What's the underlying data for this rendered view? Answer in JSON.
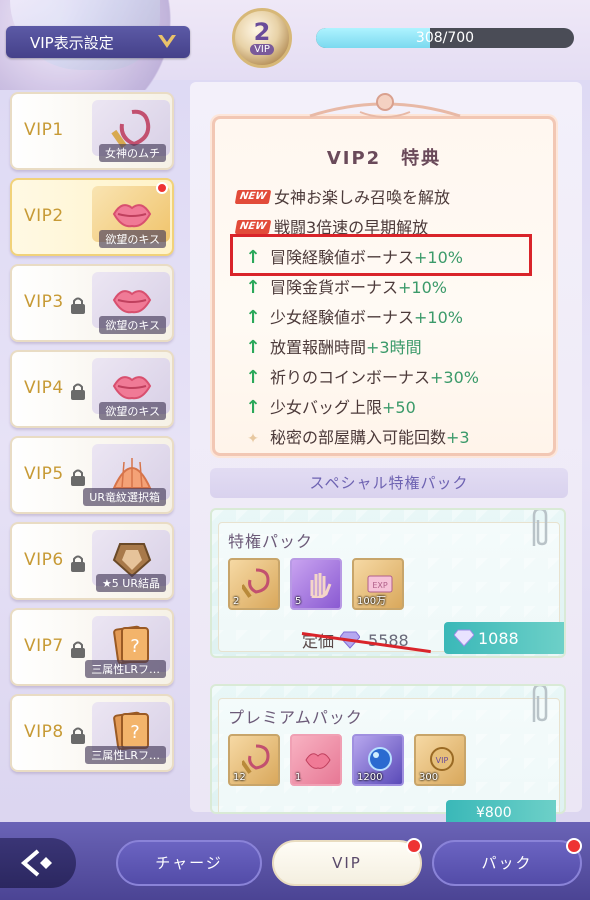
{
  "header": {
    "vip_settings_label": "VIP表示設定",
    "vip_level": "2",
    "vip_word": "VIP",
    "exp_text": "308/700",
    "exp_progress": 0.44
  },
  "sidebar": {
    "items": [
      {
        "label": "VIP1",
        "reward": "女神のムチ",
        "locked": false,
        "selected": false,
        "badge": false
      },
      {
        "label": "VIP2",
        "reward": "欲望のキス",
        "locked": false,
        "selected": true,
        "badge": true
      },
      {
        "label": "VIP3",
        "reward": "欲望のキス",
        "locked": true,
        "selected": false,
        "badge": false
      },
      {
        "label": "VIP4",
        "reward": "欲望のキス",
        "locked": true,
        "selected": false,
        "badge": false
      },
      {
        "label": "VIP5",
        "reward": "UR竜紋選択箱",
        "locked": true,
        "selected": false,
        "badge": false
      },
      {
        "label": "VIP6",
        "reward": "★5 UR結晶",
        "locked": true,
        "selected": false,
        "badge": false
      },
      {
        "label": "VIP7",
        "reward": "三属性LRフ…",
        "locked": true,
        "selected": false,
        "badge": false
      },
      {
        "label": "VIP8",
        "reward": "三属性LRフ…",
        "locked": true,
        "selected": false,
        "badge": false
      }
    ]
  },
  "benefits": {
    "title": "VIP2　特典",
    "new_tag": "NEW",
    "items": [
      {
        "text": "女神お楽しみ召喚を解放",
        "value": "",
        "marker": "new"
      },
      {
        "text": "戦闘3倍速の早期解放",
        "value": "",
        "marker": "new"
      },
      {
        "text": "冒険経験値ボーナス",
        "value": "+10%",
        "marker": "up"
      },
      {
        "text": "冒険金貨ボーナス",
        "value": "+10%",
        "marker": "up"
      },
      {
        "text": "少女経験値ボーナス",
        "value": "+10%",
        "marker": "up"
      },
      {
        "text": "放置報酬時間",
        "value": "+3時間",
        "marker": "up"
      },
      {
        "text": "祈りのコインボーナス",
        "value": "+30%",
        "marker": "up"
      },
      {
        "text": "少女バッグ上限",
        "value": "+50",
        "marker": "up"
      },
      {
        "text": "秘密の部屋購入可能回数",
        "value": "+3",
        "marker": "sparkle"
      }
    ]
  },
  "special": {
    "section_title": "スペシャル特権パック",
    "packs": [
      {
        "title": "特権パック",
        "items": [
          {
            "qty": "2",
            "kind": "whip",
            "style": "gold"
          },
          {
            "qty": "5",
            "kind": "hand",
            "style": "purple"
          },
          {
            "qty": "100万",
            "kind": "exp",
            "style": "gold"
          }
        ],
        "orig_label": "定価",
        "orig_price": "5588",
        "sale_price": "1088"
      },
      {
        "title": "プレミアムパック",
        "items": [
          {
            "qty": "12",
            "kind": "whip",
            "style": "gold"
          },
          {
            "qty": "1",
            "kind": "kiss",
            "style": "pink"
          },
          {
            "qty": "1200",
            "kind": "orb",
            "style": "blue"
          },
          {
            "qty": "300",
            "kind": "vip",
            "style": "gold"
          }
        ],
        "sale_price_partial": "¥800"
      }
    ]
  },
  "nav": {
    "charge": "チャージ",
    "vip": "VIP",
    "pack": "パック"
  }
}
